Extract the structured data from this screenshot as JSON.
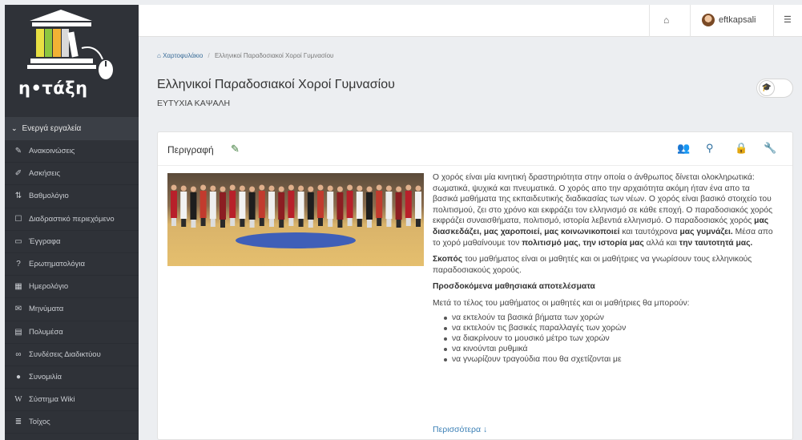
{
  "app": {
    "logo_text": "η•τάξη",
    "logo_icon": "library-books-mouse-icon"
  },
  "sidebar": {
    "section_label": "Ενεργά εργαλεία",
    "items": [
      {
        "label": "Ανακοινώσεις",
        "icon": "bullhorn-icon"
      },
      {
        "label": "Ασκήσεις",
        "icon": "edit-icon"
      },
      {
        "label": "Βαθμολόγιο",
        "icon": "sort-icon"
      },
      {
        "label": "Διαδραστικό περιεχόμενο",
        "icon": "checkbox-icon"
      },
      {
        "label": "Έγγραφα",
        "icon": "folder-icon"
      },
      {
        "label": "Ερωτηματολόγια",
        "icon": "question-icon"
      },
      {
        "label": "Ημερολόγιο",
        "icon": "calendar-icon"
      },
      {
        "label": "Μηνύματα",
        "icon": "envelope-icon"
      },
      {
        "label": "Πολυμέσα",
        "icon": "film-icon"
      },
      {
        "label": "Συνδέσεις Διαδικτύου",
        "icon": "link-icon"
      },
      {
        "label": "Συνομιλία",
        "icon": "comment-icon"
      },
      {
        "label": "Σύστημα Wiki",
        "icon": "wiki-icon"
      },
      {
        "label": "Τοίχος",
        "icon": "list-icon"
      }
    ]
  },
  "topbar": {
    "username": "eftkapsali"
  },
  "breadcrumb": {
    "root": "Χαρτοφυλάκιο",
    "separator": "/",
    "current": "Ελληνικοί Παραδοσιακοί Χοροί Γυμνασίου"
  },
  "course": {
    "title": "Ελληνικοί Παραδοσιακοί Χοροί Γυμνασίου",
    "teacher": "ΕΥΤΥΧΙΑ ΚΑΨΑΛΗ"
  },
  "panel": {
    "heading": "Περιγραφή",
    "description": {
      "p1_part1": "Ο χορός είναι μία κινητική δραστηριότητα στην οποία ο άνθρωπος δίνεται ολοκληρωτικά: σωματικά, ψυχικά και πνευματικά. Ο χορός απο την αρχαιότητα ακόμη ήταν ένα απο τα βασικά μαθήματα της εκπαιδευτικής διαδικασίας των νέων. Ο χορός είναι βασικό στοιχείο του πολιτισμού, ζει στο χρόνο και εκφράζει τον ελληνισμό σε κάθε εποχή. Ο παραδοσιακός χορός εκφράζει συναισθήματα, πολιτισμό, ιστορία λεβεντιά ελληνισμό. Ο παραδοσιακός χορός ",
      "p1_bold1": "μας διασκεδάζει, μας χαροποιεί, μας κοινωνικοποιεί",
      "p1_part2": " και ταυτόχρονα ",
      "p1_bold2": "μας γυμνάζει.",
      "p1_part3": " Μέσα απο το χορό μαθαίνουμε τον ",
      "p1_bold3": "πολιτισμό μας, την ιστορία μας",
      "p1_part4": " αλλά και ",
      "p1_bold4": "την ταυτοτητά μας.",
      "p2_bold": "Σκοπός",
      "p2_rest": " του μαθήματος είναι οι μαθητές και οι μαθήτριες να γνωρίσουν τους ελληνικούς παραδοσιακούς χορούς.",
      "goals_heading": "Προσδοκόμενα μαθησιακά αποτελέσματα",
      "goals_intro": "Μετά το τέλος του μαθήματος οι μαθητές και οι μαθήτριες θα μπορούν:",
      "goals": [
        "να εκτελούν τα βασικά βήματα των χορών",
        "να εκτελούν τις βασικές παραλλαγές των χορών",
        "να διακρίνουν το μουσικό μέτρο των χορών",
        "να κινούνται ρυθμικά",
        "να γνωρίζουν τραγούδια που θα σχετίζονται με"
      ]
    },
    "more_link": "Περισσότερα"
  },
  "colors": {
    "sidebar_bg": "#2f3238",
    "link_blue": "#3a7fb5",
    "tool_blue": "#2a6d9e",
    "edit_green": "#3e7c3a"
  }
}
